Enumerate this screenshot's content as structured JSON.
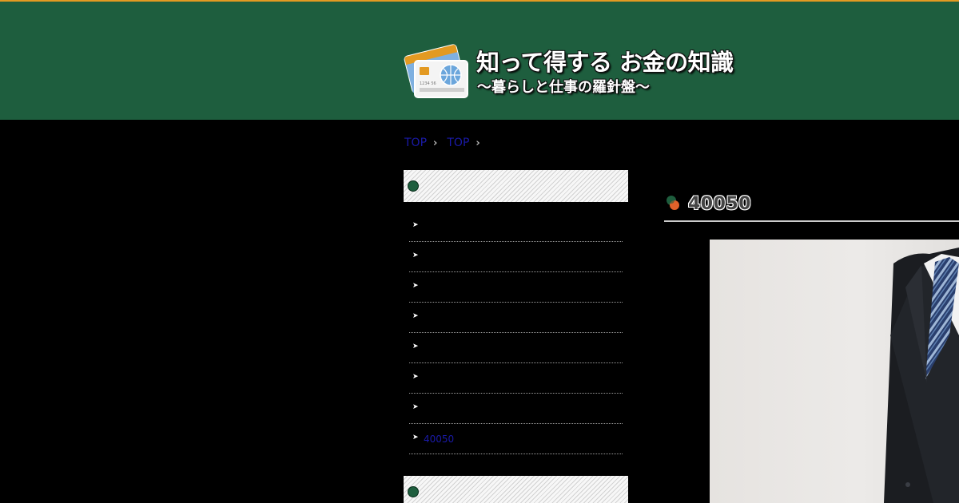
{
  "site": {
    "title": "知って得する お金の知識",
    "subtitle": "～暮らしと仕事の羅針盤～",
    "logo_card_number": "1234 56"
  },
  "breadcrumb": [
    {
      "label": "TOP"
    },
    {
      "label": "TOP"
    }
  ],
  "sidebar": {
    "menu_items": [
      {
        "label": ""
      },
      {
        "label": ""
      },
      {
        "label": ""
      },
      {
        "label": ""
      },
      {
        "label": ""
      },
      {
        "label": ""
      },
      {
        "label": ""
      },
      {
        "label": "40050"
      }
    ]
  },
  "main": {
    "page_title": "40050",
    "image": "photo of a man in a dark suit and striped tie"
  },
  "colors": {
    "header_bg": "#1e5e3e",
    "header_top_border": "#e39a22",
    "page_bg": "#000000",
    "link": "#1a1aa8"
  }
}
